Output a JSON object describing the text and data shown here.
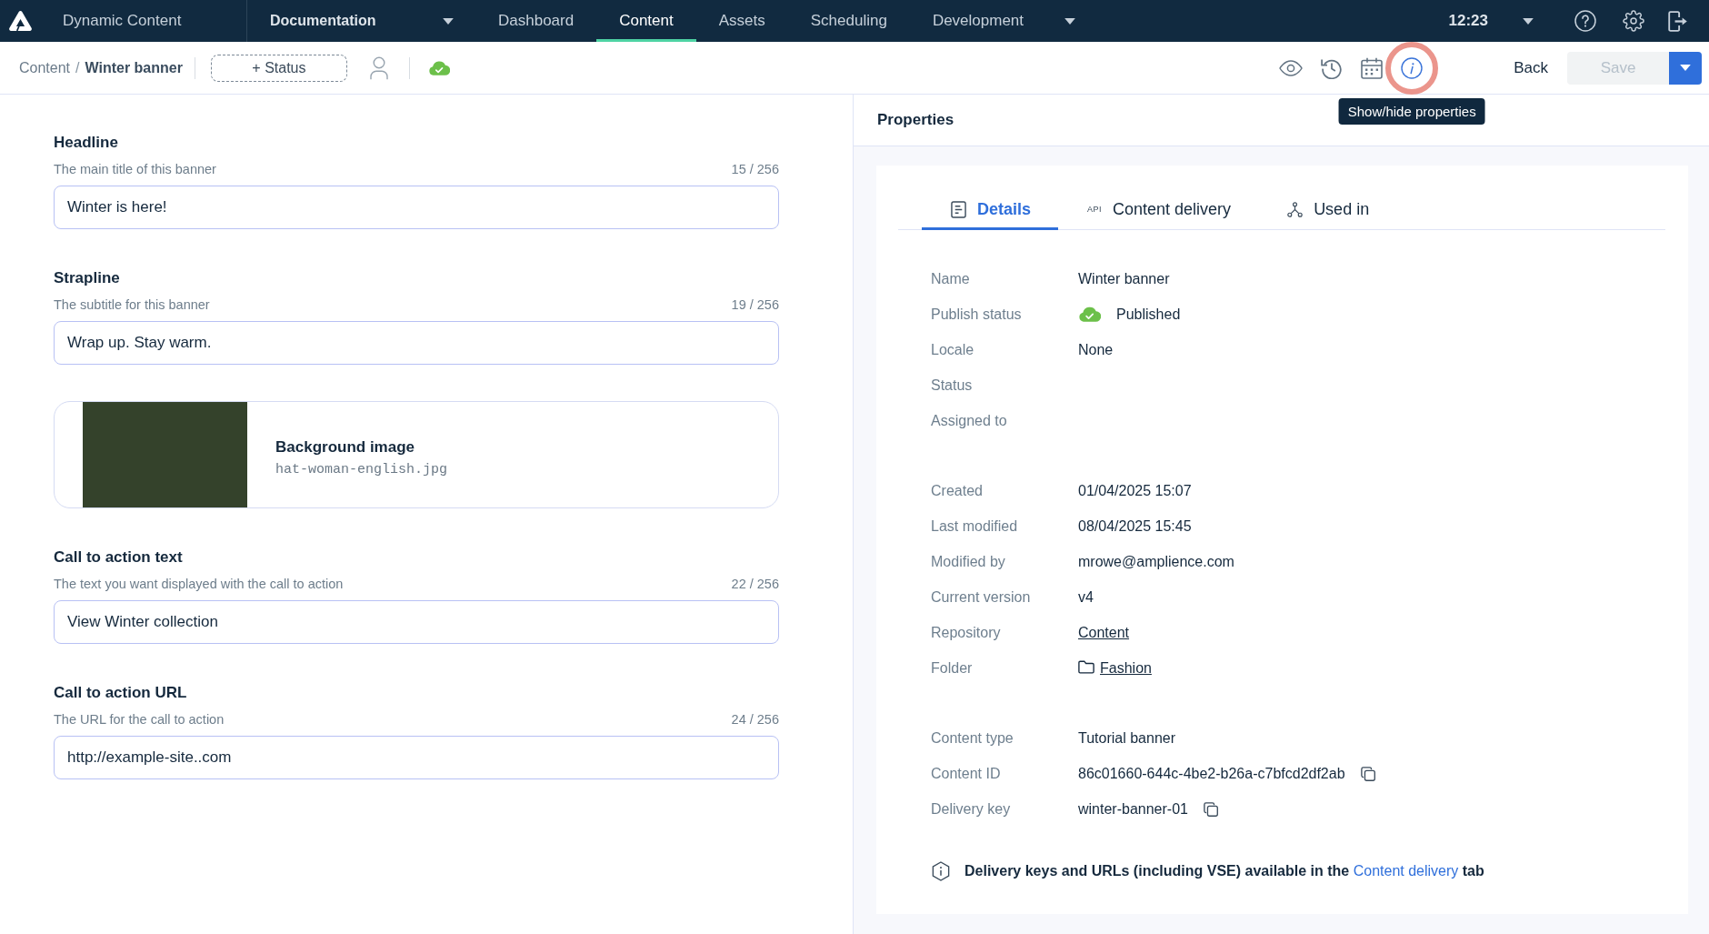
{
  "top_bar": {
    "product": "Dynamic Content",
    "hub": "Documentation",
    "nav": [
      {
        "label": "Dashboard",
        "selected": false,
        "menu": false
      },
      {
        "label": "Content",
        "selected": true,
        "menu": false
      },
      {
        "label": "Assets",
        "selected": false,
        "menu": false
      },
      {
        "label": "Scheduling",
        "selected": false,
        "menu": false
      },
      {
        "label": "Development",
        "selected": false,
        "menu": true
      }
    ],
    "time": "12:23"
  },
  "toolbar": {
    "breadcrumb": [
      {
        "label": "Content",
        "current": false
      },
      {
        "label": "Winter banner",
        "current": true
      }
    ],
    "separator": "/",
    "status_button": "+ Status",
    "published": true,
    "actions": [
      {
        "kind": "preview",
        "selected": false,
        "highlighted": false
      },
      {
        "kind": "history",
        "selected": false,
        "highlighted": false
      },
      {
        "kind": "schedule",
        "selected": false,
        "highlighted": false
      },
      {
        "kind": "properties",
        "selected": true,
        "highlighted": true,
        "tooltip": "Show/hide properties"
      }
    ],
    "back": "Back",
    "save": {
      "label": "Save",
      "disabled": true
    }
  },
  "form": {
    "fields": [
      {
        "kind": "text",
        "label": "Headline",
        "hint": "The main title of this banner",
        "count": "15 / 256",
        "value": "Winter is here!"
      },
      {
        "kind": "text",
        "label": "Strapline",
        "hint": "The subtitle for this banner",
        "count": "19 / 256",
        "value": "Wrap up. Stay warm."
      },
      {
        "kind": "image",
        "title": "Background image",
        "filename": "hat-woman-english.jpg"
      },
      {
        "kind": "text",
        "label": "Call to action text",
        "hint": "The text you want displayed with the call to action",
        "count": "22 / 256",
        "value": "View Winter collection"
      },
      {
        "kind": "text",
        "label": "Call to action URL",
        "hint": "The URL for the call to action",
        "count": "24 / 256",
        "value": "http://example-site..com"
      }
    ]
  },
  "properties": {
    "title": "Properties",
    "tabs": [
      {
        "kind": "details",
        "label": "Details",
        "selected": true
      },
      {
        "kind": "delivery",
        "badge": "API",
        "label": "Content delivery",
        "selected": false
      },
      {
        "kind": "usage",
        "label": "Used in",
        "selected": false
      }
    ],
    "groups": [
      {
        "rows": [
          {
            "kind": "text",
            "label": "Name",
            "value": "Winter banner"
          },
          {
            "kind": "status",
            "label": "Publish status",
            "value": "Published",
            "published": true
          },
          {
            "kind": "text",
            "label": "Locale",
            "value": "None"
          },
          {
            "kind": "text",
            "label": "Status"
          },
          {
            "kind": "text",
            "label": "Assigned to"
          }
        ]
      },
      {
        "rows": [
          {
            "kind": "text",
            "label": "Created",
            "value": "01/04/2025 15:07"
          },
          {
            "kind": "text",
            "label": "Last modified",
            "value": "08/04/2025 15:45"
          },
          {
            "kind": "text",
            "label": "Modified by",
            "value": "mrowe@amplience.com"
          },
          {
            "kind": "text",
            "label": "Current version",
            "value": "v4"
          },
          {
            "kind": "link",
            "label": "Repository",
            "value": "Content"
          },
          {
            "kind": "folder",
            "label": "Folder",
            "value": "Fashion"
          }
        ]
      },
      {
        "rows": [
          {
            "kind": "text",
            "label": "Content type",
            "value": "Tutorial banner"
          },
          {
            "kind": "copy",
            "label": "Content ID",
            "value": "86c01660-644c-4be2-b26a-c7bfcd2df2ab"
          },
          {
            "kind": "copy",
            "label": "Delivery key",
            "value": "winter-banner-01"
          }
        ]
      }
    ],
    "note": {
      "text": "Delivery keys and URLs (including VSE) available in the",
      "link": "Content delivery",
      "after": "tab"
    }
  }
}
